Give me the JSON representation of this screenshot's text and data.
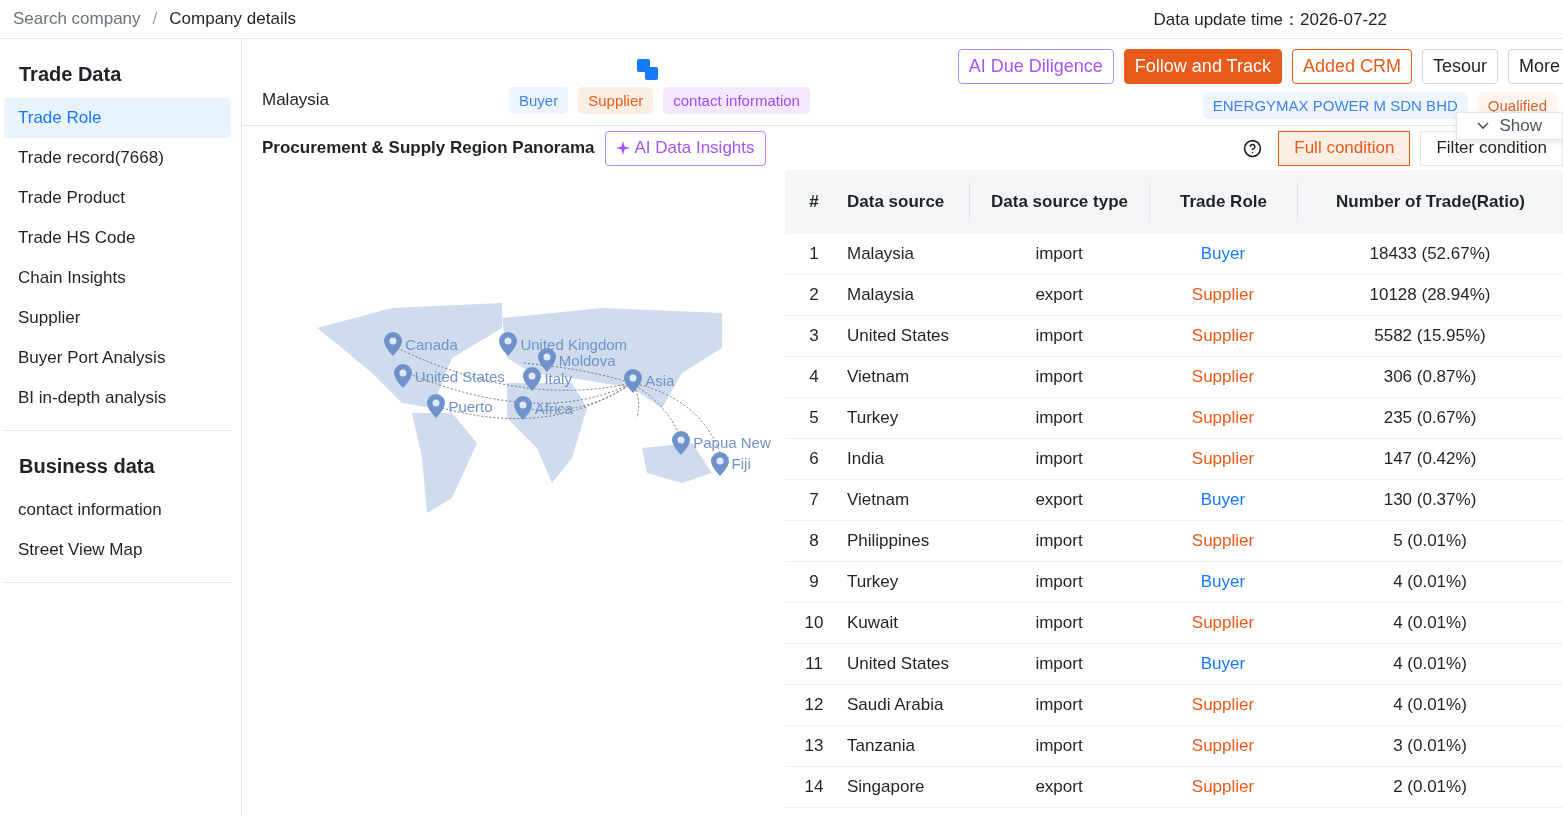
{
  "breadcrumb": [
    {
      "label": "Search company",
      "kind": "link"
    },
    {
      "label": "Company details",
      "kind": "current"
    }
  ],
  "separator": "/",
  "update": {
    "label": "Data update time：",
    "value": "2026-07-22"
  },
  "sidebar": {
    "sections": [
      {
        "title": "Trade Data",
        "items": [
          {
            "label": "Trade Role",
            "selected": true
          },
          {
            "label": "Trade record(7668)",
            "selected": false
          },
          {
            "label": "Trade Product",
            "selected": false
          },
          {
            "label": "Trade HS Code",
            "selected": false
          },
          {
            "label": "Chain Insights",
            "selected": false
          },
          {
            "label": "Supplier",
            "selected": false
          },
          {
            "label": "Buyer Port Analysis",
            "selected": false
          },
          {
            "label": "BI in-depth analysis",
            "selected": false
          }
        ]
      },
      {
        "title": "Business data",
        "items": [
          {
            "label": "contact information",
            "selected": false
          },
          {
            "label": "Street View Map",
            "selected": false
          }
        ]
      }
    ]
  },
  "company": {
    "country": "Malaysia",
    "tags": [
      {
        "label": "Buyer",
        "kind": "blue",
        "muted": true
      },
      {
        "label": "Supplier",
        "kind": "orange",
        "muted": false
      },
      {
        "label": "contact information",
        "kind": "purple",
        "muted": false
      }
    ],
    "actions": [
      {
        "label": "AI Due Diligence",
        "kind": "ai"
      },
      {
        "label": "Follow and Track",
        "kind": "primary"
      },
      {
        "label": "Added CRM",
        "kind": "outline"
      },
      {
        "label": "Tesour",
        "kind": "plain"
      },
      {
        "label": "More",
        "kind": "plain"
      }
    ],
    "name_tags": [
      {
        "label": "ENERGYMAX POWER M SDN BHD",
        "kind": "blue",
        "muted": true
      },
      {
        "label": "Qualified",
        "kind": "orange",
        "muted": true
      }
    ],
    "show": "Show"
  },
  "section": {
    "title": "Procurement & Supply Region Panorama",
    "ai_button": "AI Data Insights",
    "filters": [
      {
        "label": "Full condition",
        "selected": true
      },
      {
        "label": "Filter condition",
        "selected": false
      }
    ]
  },
  "map": {
    "pins": [
      {
        "label": "Canada"
      },
      {
        "label": "United States"
      },
      {
        "label": "Puerto"
      },
      {
        "label": "United Kingdom"
      },
      {
        "label": "Moldova"
      },
      {
        "label": "Italy"
      },
      {
        "label": "Africa"
      },
      {
        "label": "Asia"
      },
      {
        "label": "Papua New"
      },
      {
        "label": "Fiji"
      }
    ]
  },
  "table": {
    "columns": [
      "#",
      "Data source",
      "Data source type",
      "Trade Role",
      "Number of Trade(Ratio)"
    ],
    "rows": [
      {
        "n": "1",
        "source": "Malaysia",
        "type": "import",
        "role": "Buyer",
        "kind": "buyer",
        "count": "18433 (52.67%)"
      },
      {
        "n": "2",
        "source": "Malaysia",
        "type": "export",
        "role": "Supplier",
        "kind": "supplier",
        "count": "10128 (28.94%)"
      },
      {
        "n": "3",
        "source": "United States",
        "type": "import",
        "role": "Supplier",
        "kind": "supplier",
        "count": "5582 (15.95%)"
      },
      {
        "n": "4",
        "source": "Vietnam",
        "type": "import",
        "role": "Supplier",
        "kind": "supplier",
        "count": "306 (0.87%)"
      },
      {
        "n": "5",
        "source": "Turkey",
        "type": "import",
        "role": "Supplier",
        "kind": "supplier",
        "count": "235 (0.67%)"
      },
      {
        "n": "6",
        "source": "India",
        "type": "import",
        "role": "Supplier",
        "kind": "supplier",
        "count": "147 (0.42%)"
      },
      {
        "n": "7",
        "source": "Vietnam",
        "type": "export",
        "role": "Buyer",
        "kind": "buyer",
        "count": "130 (0.37%)"
      },
      {
        "n": "8",
        "source": "Philippines",
        "type": "import",
        "role": "Supplier",
        "kind": "supplier",
        "count": "5 (0.01%)"
      },
      {
        "n": "9",
        "source": "Turkey",
        "type": "import",
        "role": "Buyer",
        "kind": "buyer",
        "count": "4 (0.01%)"
      },
      {
        "n": "10",
        "source": "Kuwait",
        "type": "import",
        "role": "Supplier",
        "kind": "supplier",
        "count": "4 (0.01%)"
      },
      {
        "n": "11",
        "source": "United States",
        "type": "import",
        "role": "Buyer",
        "kind": "buyer",
        "count": "4 (0.01%)"
      },
      {
        "n": "12",
        "source": "Saudi Arabia",
        "type": "import",
        "role": "Supplier",
        "kind": "supplier",
        "count": "4 (0.01%)"
      },
      {
        "n": "13",
        "source": "Tanzania",
        "type": "import",
        "role": "Supplier",
        "kind": "supplier",
        "count": "3 (0.01%)"
      },
      {
        "n": "14",
        "source": "Singapore",
        "type": "export",
        "role": "Supplier",
        "kind": "supplier",
        "count": "2 (0.01%)"
      }
    ]
  }
}
